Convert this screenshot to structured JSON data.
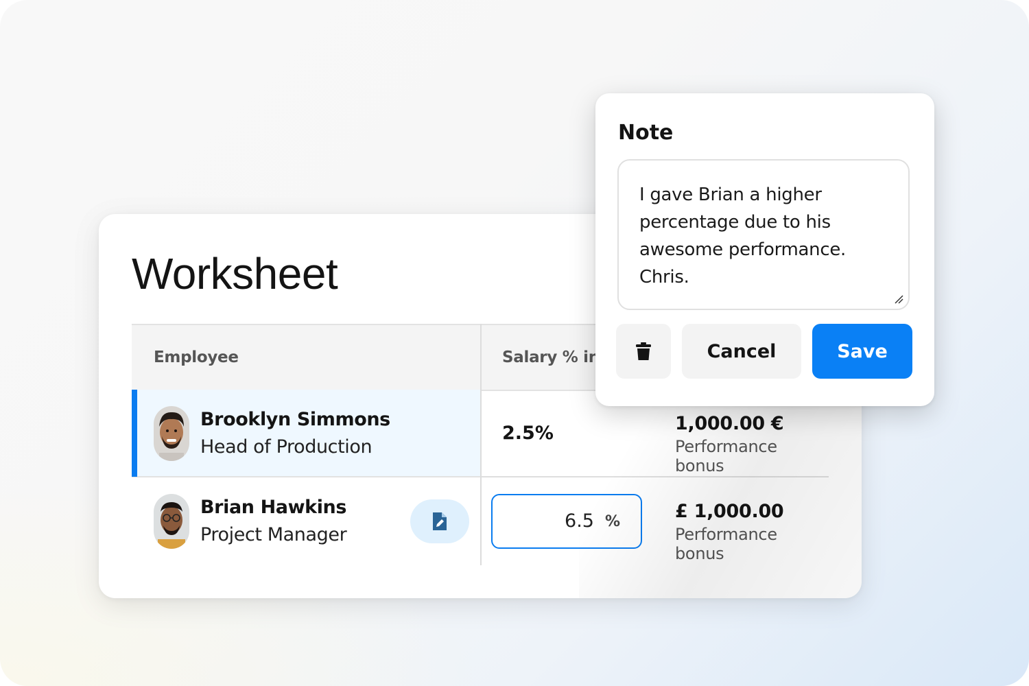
{
  "worksheet": {
    "title": "Worksheet",
    "columns": [
      "Employee",
      "Salary % in"
    ],
    "rows": [
      {
        "name": "Brooklyn Simmons",
        "role": "Head of Production",
        "salary_pct": "2.5%",
        "amount": "1,000.00 €",
        "bonus_label": "Performance bonus",
        "selected": true
      },
      {
        "name": "Brian Hawkins",
        "role": "Project Manager",
        "salary_pct_input": "6.5",
        "salary_pct_unit": "%",
        "amount": "£ 1,000.00",
        "bonus_label": "Performance bonus",
        "has_note": true
      }
    ]
  },
  "note_popover": {
    "title": "Note",
    "text": "I gave Brian a higher percentage due to his awesome performance. Chris.",
    "delete_icon": "trash-icon",
    "cancel_label": "Cancel",
    "save_label": "Save"
  },
  "colors": {
    "accent": "#0a80f5",
    "selected_row_bg": "#eff8ff",
    "note_button_bg": "#dff0fd"
  }
}
